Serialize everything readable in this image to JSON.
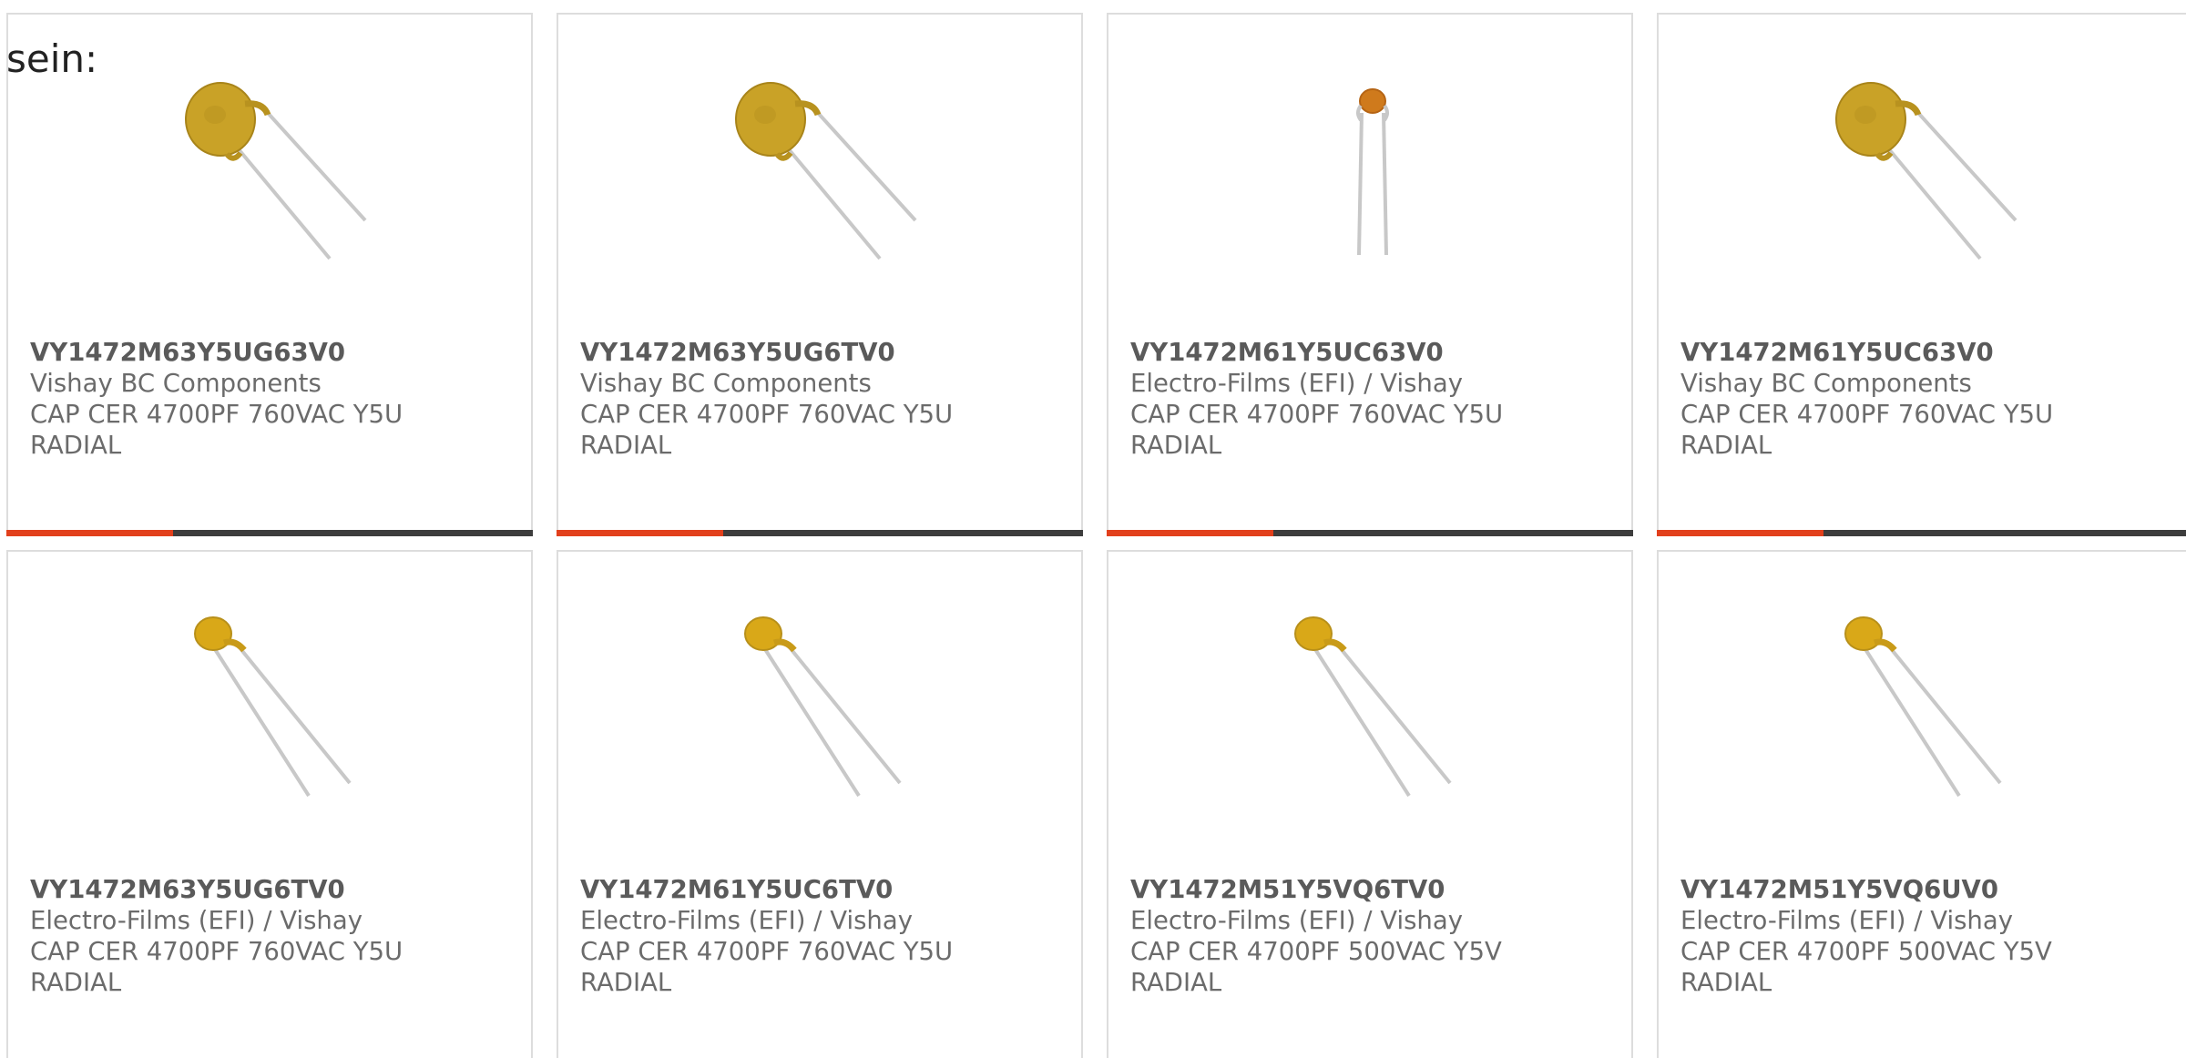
{
  "intro_text": "sein:",
  "accent_color": "#e2401c",
  "bar_color": "#3d3d3d",
  "products": [
    {
      "part": "VY1472M63Y5UG63V0",
      "manufacturer": "Vishay BC Components",
      "description": "CAP CER 4700PF 760VAC Y5U",
      "package": "RADIAL",
      "image_icon": "disc-capacitor-large-icon"
    },
    {
      "part": "VY1472M63Y5UG6TV0",
      "manufacturer": "Vishay BC Components",
      "description": "CAP CER 4700PF 760VAC Y5U",
      "package": "RADIAL",
      "image_icon": "disc-capacitor-large-icon"
    },
    {
      "part": "VY1472M61Y5UC63V0",
      "manufacturer": "Electro-Films (EFI) / Vishay",
      "description": "CAP CER 4700PF 760VAC Y5U",
      "package": "RADIAL",
      "image_icon": "disc-capacitor-small-icon"
    },
    {
      "part": "VY1472M61Y5UC63V0",
      "manufacturer": "Vishay BC Components",
      "description": "CAP CER 4700PF 760VAC Y5U",
      "package": "RADIAL",
      "image_icon": "disc-capacitor-large-icon"
    },
    {
      "part": "VY1472M63Y5UG6TV0",
      "manufacturer": "Electro-Films (EFI) / Vishay",
      "description": "CAP CER 4700PF 760VAC Y5U",
      "package": "RADIAL",
      "image_icon": "disc-capacitor-medium-icon"
    },
    {
      "part": "VY1472M61Y5UC6TV0",
      "manufacturer": "Electro-Films (EFI) / Vishay",
      "description": "CAP CER 4700PF 760VAC Y5U",
      "package": "RADIAL",
      "image_icon": "disc-capacitor-medium-icon"
    },
    {
      "part": "VY1472M51Y5VQ6TV0",
      "manufacturer": "Electro-Films (EFI) / Vishay",
      "description": "CAP CER 4700PF 500VAC Y5V",
      "package": "RADIAL",
      "image_icon": "disc-capacitor-medium-icon"
    },
    {
      "part": "VY1472M51Y5VQ6UV0",
      "manufacturer": "Electro-Films (EFI) / Vishay",
      "description": "CAP CER 4700PF 500VAC Y5V",
      "package": "RADIAL",
      "image_icon": "disc-capacitor-medium-icon"
    }
  ]
}
